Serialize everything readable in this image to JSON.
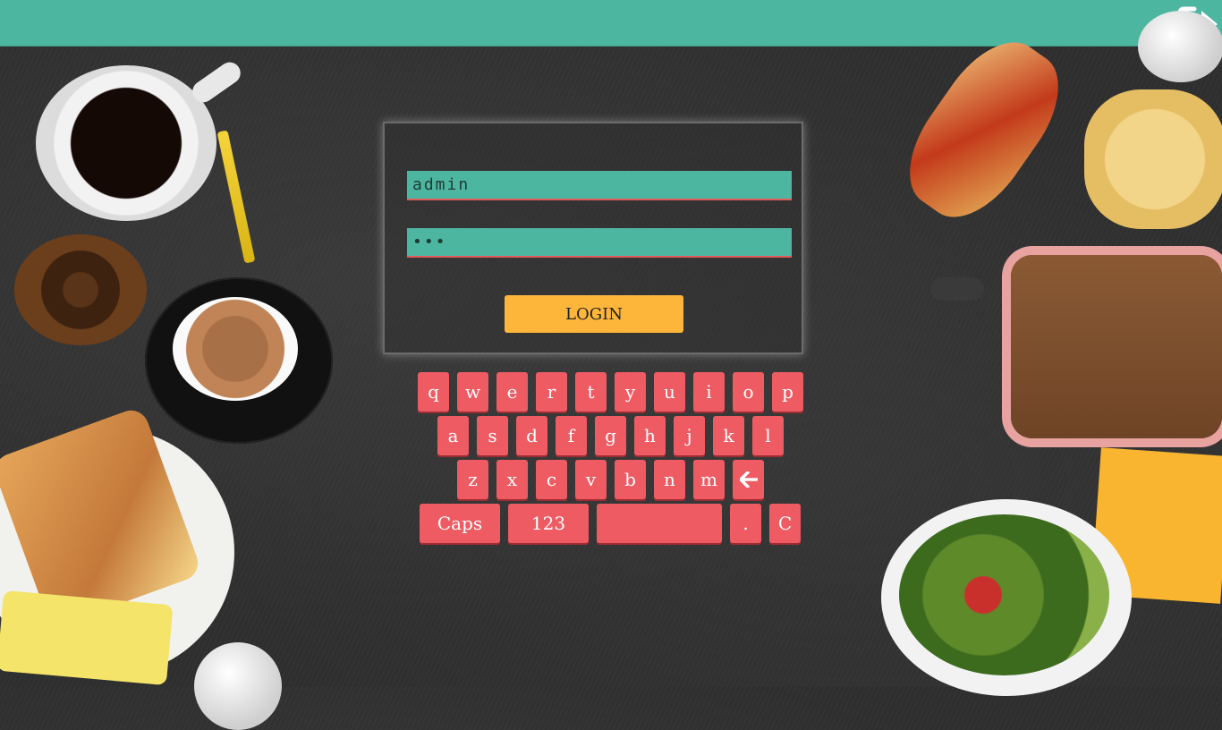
{
  "topbar": {
    "logout_icon": "logout-arrow-icon",
    "color": "#4db6a0"
  },
  "login": {
    "username_value": "admin",
    "password_masked": "•••",
    "login_label": "LOGIN"
  },
  "keyboard": {
    "row1": [
      "q",
      "w",
      "e",
      "r",
      "t",
      "y",
      "u",
      "i",
      "o",
      "p"
    ],
    "row2": [
      "a",
      "s",
      "d",
      "f",
      "g",
      "h",
      "j",
      "k",
      "l"
    ],
    "row3": [
      "z",
      "x",
      "c",
      "v",
      "b",
      "n",
      "m"
    ],
    "backspace_icon": "backspace-arrow-icon",
    "caps_label": "Caps",
    "numbers_label": "123",
    "space_label": "",
    "dot_label": ".",
    "clear_label": "C",
    "key_color": "#ee5b63"
  },
  "colors": {
    "accent": "#4db6a0",
    "button": "#fdb63a",
    "field_underline": "#e05a5a"
  }
}
